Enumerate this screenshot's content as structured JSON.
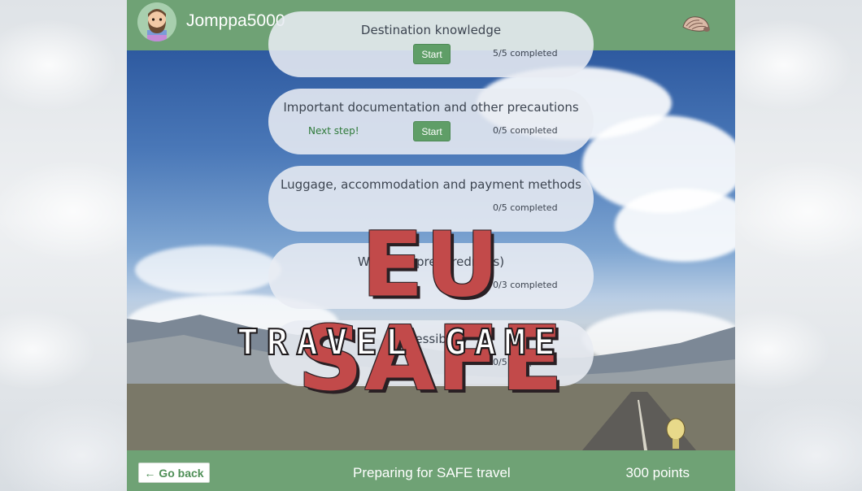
{
  "header": {
    "username": "Jomppa5000",
    "avatar_icon": "bearded-man-avatar-icon",
    "menu_icon": "shell-icon"
  },
  "categories": [
    {
      "title": "Destination knowledge",
      "next_step": "",
      "button_label": "Start",
      "progress": "5/5 completed"
    },
    {
      "title": "Important documentation and other precautions",
      "next_step": "Next step!",
      "button_label": "Start",
      "progress": "0/5 completed"
    },
    {
      "title": "Luggage, accommodation and payment methods",
      "next_step": "",
      "button_label": "",
      "progress": "0/5 completed"
    },
    {
      "title": "What if? (preparedness)",
      "next_step": "",
      "button_label": "",
      "progress": "0/3 completed"
    },
    {
      "title": "Accessibility",
      "next_step": "",
      "button_label": "",
      "progress": "0/5 completed"
    }
  ],
  "logo": {
    "main": "EU SAFE",
    "sub": "TRAVEL GAME"
  },
  "footer": {
    "back_label": "← Go back",
    "title": "Preparing for SAFE travel",
    "points": "300 points"
  },
  "colors": {
    "brand_green": "#6fa275",
    "button_green": "#5f9e67",
    "logo_red": "#c24a4a"
  }
}
